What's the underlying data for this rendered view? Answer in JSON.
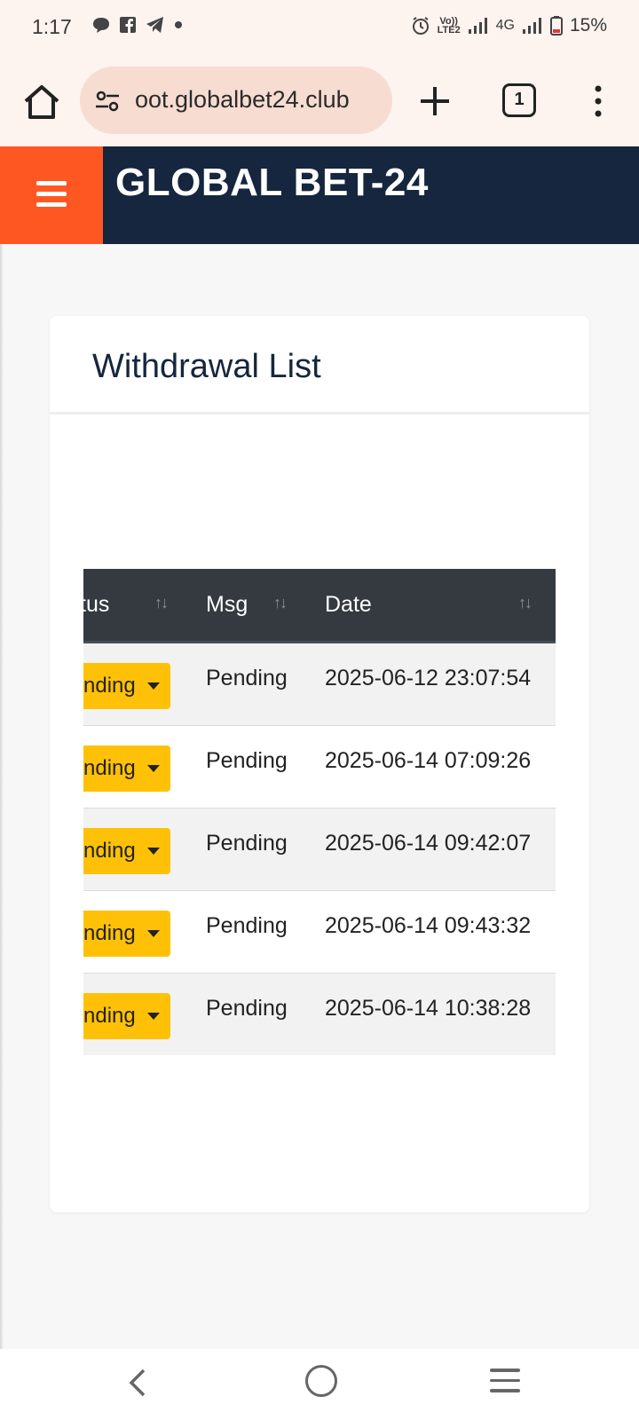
{
  "status_bar": {
    "time": "1:17",
    "battery": "15%",
    "network": "4G",
    "volte": "Vo)) LTE2"
  },
  "browser": {
    "url": "oot.globalbet24.club",
    "tab_count": "1"
  },
  "site": {
    "brand": "GLOBAL BET-24",
    "accent_color": "#ff5722",
    "header_color": "#15263e"
  },
  "card": {
    "title": "Withdrawal List"
  },
  "table": {
    "columns": {
      "status": "tus",
      "msg": "Msg",
      "date": "Date"
    },
    "rows": [
      {
        "status": "nding",
        "msg": "Pending",
        "date": "2025-06-12 23:07:54"
      },
      {
        "status": "nding",
        "msg": "Pending",
        "date": "2025-06-14 07:09:26"
      },
      {
        "status": "nding",
        "msg": "Pending",
        "date": "2025-06-14 09:42:07"
      },
      {
        "status": "nding",
        "msg": "Pending",
        "date": "2025-06-14 09:43:32"
      },
      {
        "status": "nding",
        "msg": "Pending",
        "date": "2025-06-14 10:38:28"
      }
    ],
    "status_color": "#ffc107"
  }
}
